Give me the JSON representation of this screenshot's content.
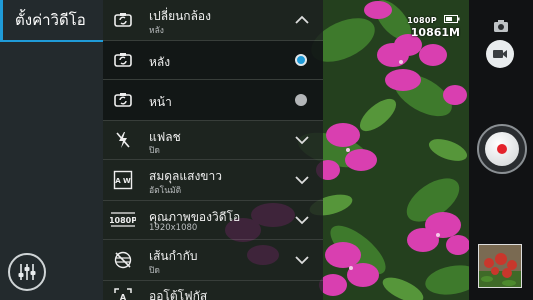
{
  "panel": {
    "title": "ตั้งค่าวิดีโอ"
  },
  "menu": {
    "switch_camera": {
      "label": "เปลี่ยนกล้อง",
      "value": "หลัง",
      "icon": "switch-camera-icon"
    },
    "camera_options": [
      {
        "label": "หลัง",
        "selected": true,
        "icon": "rear-camera-icon"
      },
      {
        "label": "หน้า",
        "selected": false,
        "icon": "front-camera-icon"
      }
    ],
    "flash": {
      "label": "แฟลช",
      "value": "ปิด",
      "icon": "flash-off-icon"
    },
    "white_balance": {
      "label": "สมดุลแสงขาว",
      "value": "อัตโนมัติ",
      "icon": "white-balance-icon",
      "badge": "A W"
    },
    "video_quality": {
      "label": "คุณภาพของวิดีโอ",
      "value": "1920x1080",
      "icon": "video-quality-icon",
      "badge": "1080P"
    },
    "grid": {
      "label": "เส้นกำกับ",
      "value": "ปิด",
      "icon": "grid-off-icon"
    },
    "autofocus": {
      "label": "ออโต้โฟกัส",
      "icon": "autofocus-icon"
    }
  },
  "status": {
    "resolution": "1080P",
    "storage": "10861M",
    "battery_icon": "battery-icon"
  },
  "colors": {
    "accent": "#1f9bd8",
    "record": "#e4232b",
    "flower": "#d93fb0",
    "leaf": "#2f6a24"
  }
}
